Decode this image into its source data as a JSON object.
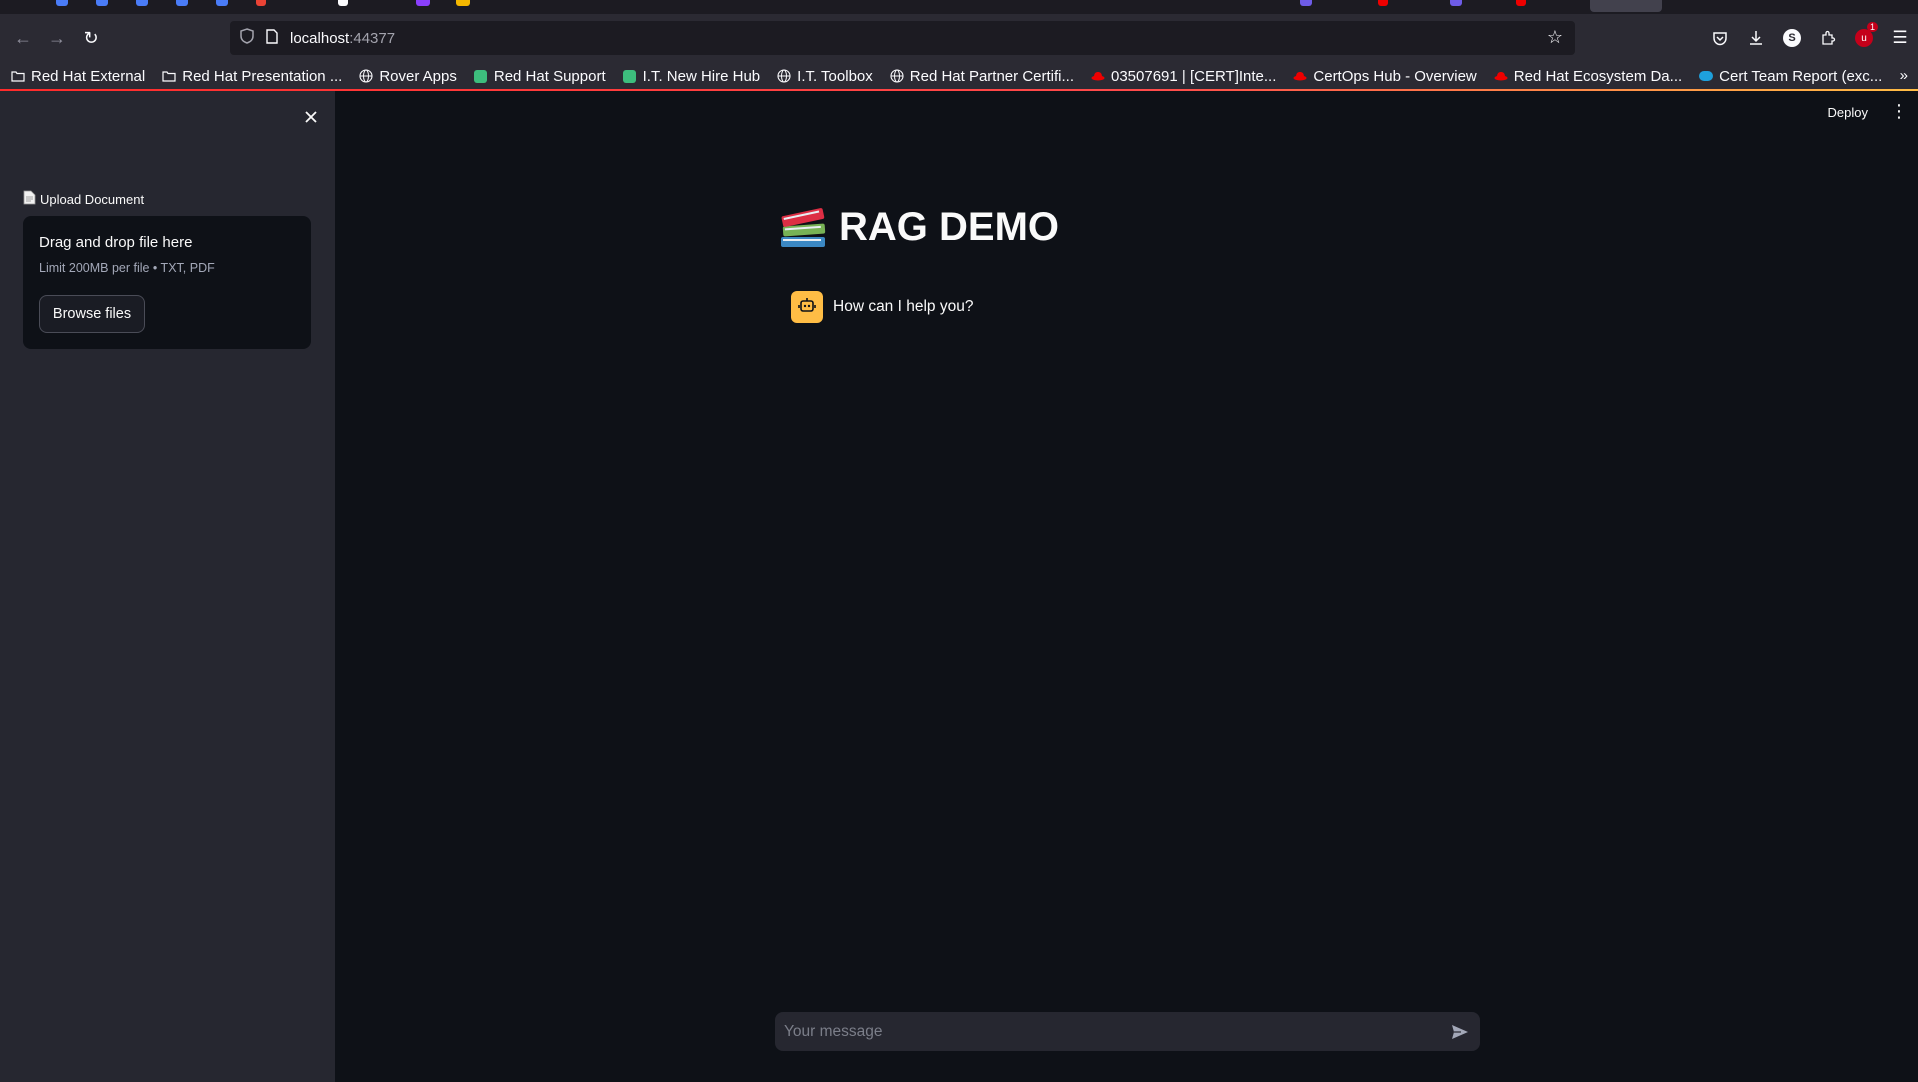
{
  "browser": {
    "url_host": "localhost",
    "url_port": ":44377",
    "toolbar_icons": [
      "pocket-icon",
      "download-icon",
      "profile-icon",
      "extensions-icon",
      "ublock-icon",
      "menu-icon"
    ],
    "extension_badge_count": "1"
  },
  "bookmarks": [
    {
      "label": "Red Hat External",
      "icon": "folder-icon"
    },
    {
      "label": "Red Hat Presentation ...",
      "icon": "folder-icon"
    },
    {
      "label": "Rover Apps",
      "icon": "globe-icon"
    },
    {
      "label": "Red Hat Support",
      "icon": "green-app-icon"
    },
    {
      "label": "I.T. New Hire Hub",
      "icon": "green-app-icon"
    },
    {
      "label": "I.T. Toolbox",
      "icon": "globe-icon"
    },
    {
      "label": "Red Hat Partner Certifi...",
      "icon": "globe-icon"
    },
    {
      "label": "03507691 | [CERT]Inte...",
      "icon": "redhat-icon"
    },
    {
      "label": "CertOps Hub - Overview",
      "icon": "redhat-icon"
    },
    {
      "label": "Red Hat Ecosystem Da...",
      "icon": "redhat-icon"
    },
    {
      "label": "Cert Team Report (exc...",
      "icon": "salesforce-icon"
    }
  ],
  "sidebar": {
    "upload_label": "Upload Document",
    "dropzone_title": "Drag and drop file here",
    "dropzone_limit": "Limit 200MB per file • TXT, PDF",
    "browse_label": "Browse files"
  },
  "header": {
    "deploy_label": "Deploy"
  },
  "main": {
    "title": "RAG DEMO",
    "messages": [
      {
        "role": "assistant",
        "text": "How can I help you?"
      }
    ],
    "input_placeholder": "Your message"
  },
  "colors": {
    "app_bg": "#0e1117",
    "sidebar_bg": "#262730",
    "bot_avatar": "#ffbd45",
    "accent_line": "#ff4b4b"
  }
}
